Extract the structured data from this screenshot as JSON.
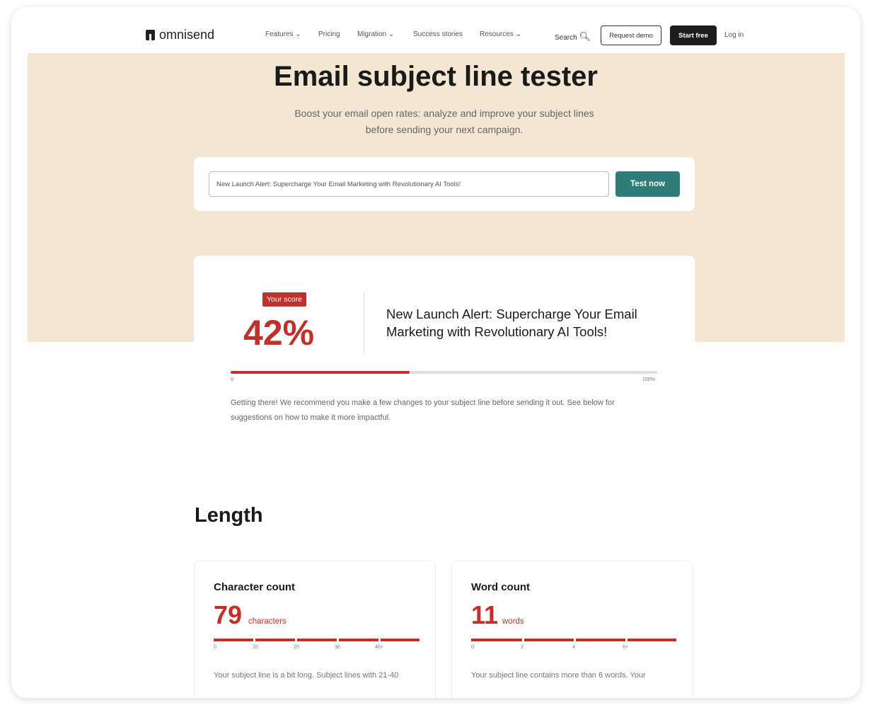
{
  "nav": {
    "brand": "omnisend",
    "items": [
      "Features",
      "Pricing",
      "Migration",
      "Success stories",
      "Resources"
    ],
    "search": "Search",
    "request_demo": "Request demo",
    "start_free": "Start free",
    "login": "Log in"
  },
  "hero": {
    "title": "Email subject line tester",
    "subtitle": "Boost your email open rates: analyze and improve your subject lines before sending your next campaign.",
    "input_value": "New Launch Alert: Supercharge Your Email Marketing with Revolutionary AI Tools!",
    "test_button": "Test now"
  },
  "score": {
    "badge": "Your score",
    "value": "42%",
    "percent": 42,
    "subject": "New Launch Alert: Supercharge Your Email Marketing with Revolutionary AI Tools!",
    "min_label": "0",
    "max_label": "100%",
    "message": "Getting there! We recommend you make a few changes to your subject line before sending it out. See below for suggestions on how to make it more impactful."
  },
  "length": {
    "title": "Length",
    "character": {
      "title": "Character count",
      "value": "79",
      "unit": "characters",
      "ticks": [
        "0",
        "10",
        "20",
        "30",
        "40+"
      ],
      "message": "Your subject line is a bit long. Subject lines with 21-40"
    },
    "word": {
      "title": "Word count",
      "value": "11",
      "unit": "words",
      "ticks": [
        "0",
        "2",
        "4",
        "6+"
      ],
      "message": "Your subject line contains more than 6 words. Your"
    }
  },
  "colors": {
    "accent": "#c0312b",
    "button": "#2f7d79",
    "hero_bg": "#f3e6d3"
  }
}
